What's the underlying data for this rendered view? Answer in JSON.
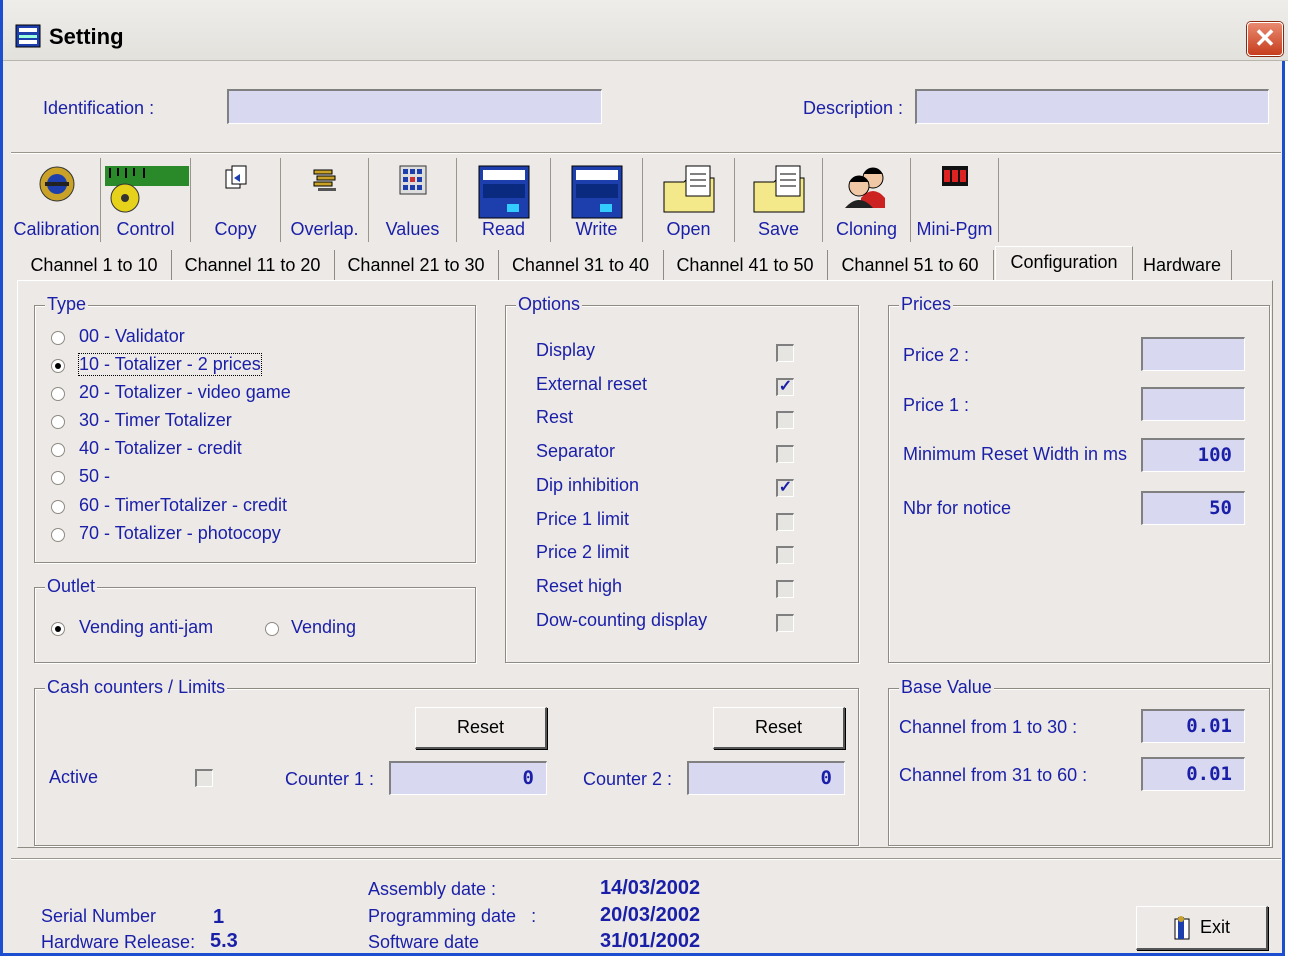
{
  "window": {
    "title": "Setting",
    "close": "✕"
  },
  "header": {
    "identification_label": "Identification :",
    "identification_value": "",
    "description_label": "Description :",
    "description_value": ""
  },
  "toolbar": [
    {
      "label": "Calibration",
      "icon": "calibration-icon"
    },
    {
      "label": "Control",
      "icon": "control-icon"
    },
    {
      "label": "Copy",
      "icon": "copy-icon"
    },
    {
      "label": "Overlap.",
      "icon": "overlap-icon"
    },
    {
      "label": "Values",
      "icon": "values-icon"
    },
    {
      "label": "Read",
      "icon": "read-icon"
    },
    {
      "label": "Write",
      "icon": "write-icon"
    },
    {
      "label": "Open",
      "icon": "open-icon"
    },
    {
      "label": "Save",
      "icon": "save-icon"
    },
    {
      "label": "Cloning",
      "icon": "cloning-icon"
    },
    {
      "label": "Mini-Pgm",
      "icon": "mini-pgm-icon"
    }
  ],
  "tabs": [
    "Channel 1 to 10",
    "Channel 11 to 20",
    "Channel 21 to 30",
    "Channel 31 to 40",
    "Channel 41 to 50",
    "Channel 51 to 60",
    "Configuration",
    "Hardware"
  ],
  "active_tab": "Configuration",
  "type_group": {
    "title": "Type",
    "options": [
      "00 - Validator",
      "10 - Totalizer - 2 prices",
      "20 - Totalizer - video game",
      "30 - Timer Totalizer",
      "40 - Totalizer - credit",
      "50 -",
      "60 - TimerTotalizer - credit",
      "70 - Totalizer - photocopy"
    ],
    "selected": "10 - Totalizer - 2 prices"
  },
  "outlet_group": {
    "title": "Outlet",
    "options": [
      "Vending anti-jam",
      "Vending"
    ],
    "selected": "Vending anti-jam"
  },
  "options_group": {
    "title": "Options",
    "items": [
      {
        "label": "Display",
        "checked": false
      },
      {
        "label": "External reset",
        "checked": true
      },
      {
        "label": "Rest",
        "checked": false
      },
      {
        "label": "Separator",
        "checked": false
      },
      {
        "label": "Dip inhibition",
        "checked": true
      },
      {
        "label": "Price 1 limit",
        "checked": false
      },
      {
        "label": "Price 2 limit",
        "checked": false
      },
      {
        "label": "Reset high",
        "checked": false
      },
      {
        "label": "Dow-counting display",
        "checked": false
      }
    ]
  },
  "prices_group": {
    "title": "Prices",
    "price2_label": "Price 2 :",
    "price2_value": "",
    "price1_label": "Price 1 :",
    "price1_value": "",
    "min_reset_label": "Minimum Reset Width in ms",
    "min_reset_value": "100",
    "notice_label": "Nbr for notice",
    "notice_value": "50"
  },
  "cash_group": {
    "title": "Cash counters / Limits",
    "active_label": "Active",
    "reset1_label": "Reset",
    "reset2_label": "Reset",
    "counter1_label": "Counter 1 :",
    "counter1_value": "0",
    "counter2_label": "Counter 2 :",
    "counter2_value": "0"
  },
  "base_group": {
    "title": "Base Value",
    "ch1_label": "Channel from  1 to 30 :",
    "ch1_value": "0.01",
    "ch2_label": "Channel from 31 to 60 :",
    "ch2_value": "0.01"
  },
  "footer": {
    "serial_label": "Serial Number",
    "serial_value": "1",
    "hw_label": "Hardware Release:",
    "hw_value": "5.3",
    "assembly_label": "Assembly date :",
    "assembly_value": "14/03/2002",
    "programming_label": "Programming date   :",
    "programming_value": "20/03/2002",
    "software_label": "Software date",
    "software_value": "31/01/2002",
    "exit_label": "Exit"
  },
  "colors": {
    "accent_text": "#1a1fa8",
    "field_bg": "#d9d8f1",
    "window_bg": "#ece9e6",
    "close_red": "#c63d1e"
  }
}
